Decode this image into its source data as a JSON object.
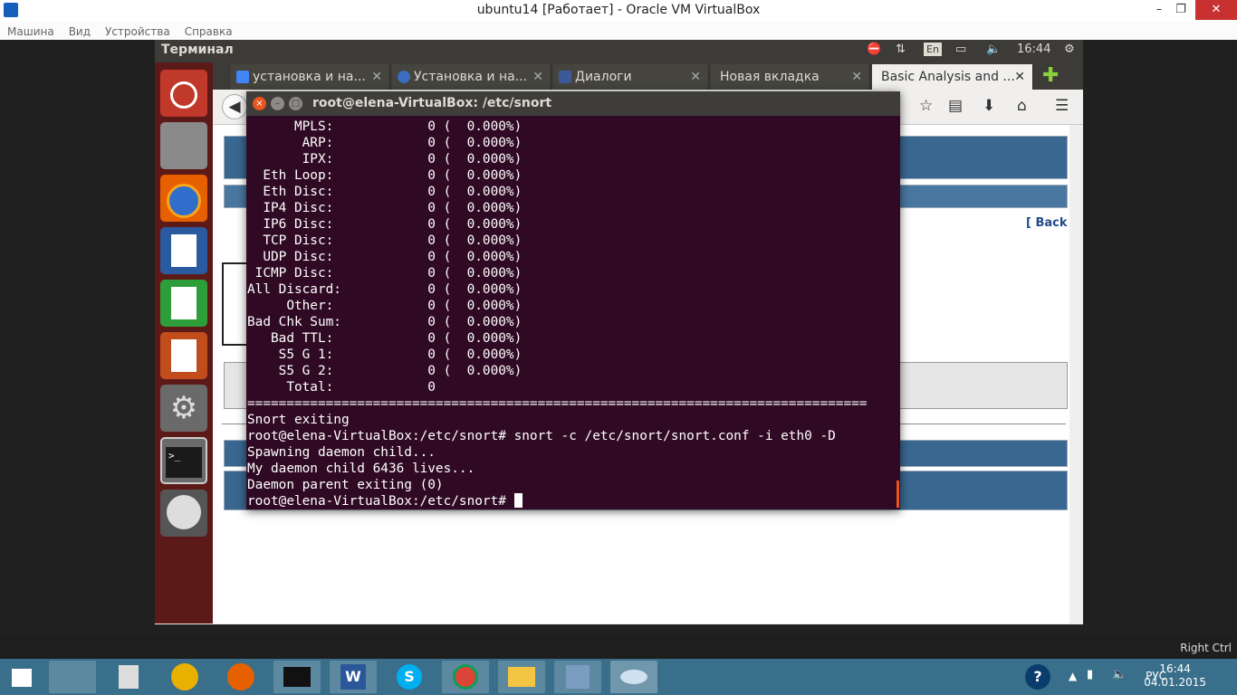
{
  "host": {
    "window_title": "ubuntu14 [Работает] - Oracle VM VirtualBox",
    "menu": [
      "Машина",
      "Вид",
      "Устройства",
      "Справка"
    ],
    "host_key": "Right Ctrl",
    "taskbar_lang": "РУС",
    "clock_time": "16:44",
    "clock_date": "04.01.2015"
  },
  "ubuntu": {
    "panel_title": "Терминал",
    "lang": "En",
    "time": "16:44"
  },
  "firefox": {
    "tabs": [
      {
        "label": "установка и на...",
        "color": "#4285f4"
      },
      {
        "label": "Установка и на...",
        "color": "#3a6dbf"
      },
      {
        "label": "Диалоги",
        "color": "#3c5a99"
      },
      {
        "label": "Новая вкладка",
        "color": ""
      },
      {
        "label": "Basic Analysis and ...",
        "color": ""
      }
    ],
    "page_back_link": "[ Back"
  },
  "terminal": {
    "title": "root@elena-VirtualBox: /etc/snort",
    "lines": [
      "      MPLS:            0 (  0.000%)",
      "       ARP:            0 (  0.000%)",
      "       IPX:            0 (  0.000%)",
      "  Eth Loop:            0 (  0.000%)",
      "  Eth Disc:            0 (  0.000%)",
      "  IP4 Disc:            0 (  0.000%)",
      "  IP6 Disc:            0 (  0.000%)",
      "  TCP Disc:            0 (  0.000%)",
      "  UDP Disc:            0 (  0.000%)",
      " ICMP Disc:            0 (  0.000%)",
      "All Discard:           0 (  0.000%)",
      "     Other:            0 (  0.000%)",
      "Bad Chk Sum:           0 (  0.000%)",
      "   Bad TTL:            0 (  0.000%)",
      "    S5 G 1:            0 (  0.000%)",
      "    S5 G 2:            0 (  0.000%)",
      "     Total:            0",
      "===============================================================================",
      "Snort exiting",
      "root@elena-VirtualBox:/etc/snort# snort -c /etc/snort/snort.conf -i eth0 -D",
      "Spawning daemon child...",
      "My daemon child 6436 lives...",
      "Daemon parent exiting (0)"
    ],
    "prompt": "root@elena-VirtualBox:/etc/snort# "
  }
}
